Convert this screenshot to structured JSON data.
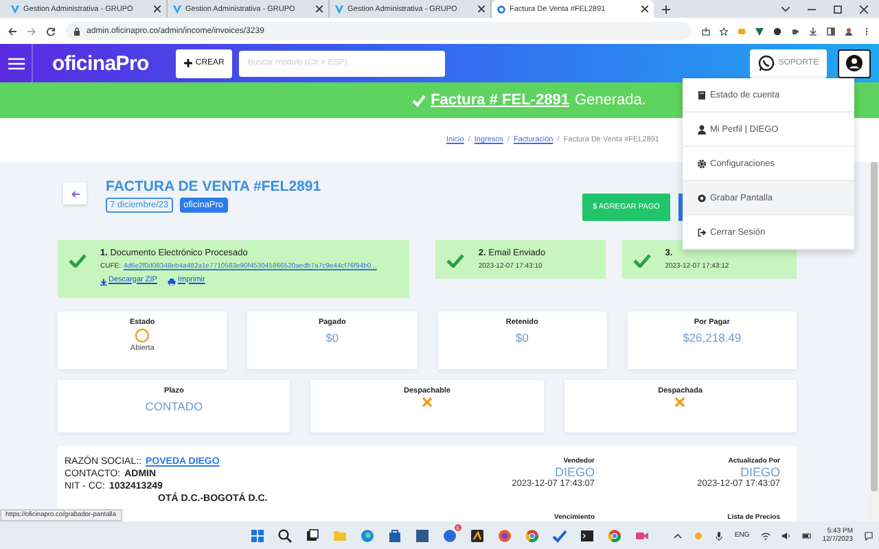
{
  "browser": {
    "tabs": [
      {
        "title": "Gestion Administrativa - GRUPO",
        "selected": false
      },
      {
        "title": "Gestion Administrativa - GRUPO",
        "selected": false
      },
      {
        "title": "Gestion Administrativa - GRUPO",
        "selected": false
      },
      {
        "title": "Factura De Venta #FEL2891",
        "selected": true
      }
    ],
    "address": "admin.oficinapro.co/admin/income/invoices/3239"
  },
  "header": {
    "logo": "oficinaPro",
    "create_button": "CREAR",
    "search": {
      "placeholder": "Buscar módulo (Ctr + ESP)"
    },
    "support_button": "SOPORTE"
  },
  "banner": {
    "link": "Factura # FEL-2891",
    "text": "Generada."
  },
  "breadcrumb_separator": "/",
  "breadcrumb": [
    {
      "label": "Inicio",
      "link": true
    },
    {
      "label": "Ingresos",
      "link": true
    },
    {
      "label": "Facturación",
      "link": true
    },
    {
      "label": "Factura De Venta #FEL2891",
      "link": false
    }
  ],
  "invoice": {
    "title": "FACTURA DE VENTA #FEL2891",
    "date": "7 diciembre/23",
    "tag": "oficinaPro",
    "pay_button": "$ AGREGAR PAGO"
  },
  "steps": [
    {
      "number": "1.",
      "title": "Documento Electrónico Procesado",
      "cufe_label": "CUFE:",
      "cufe": "4d6e2f0d08348eb4a482a1e7710583e90f453045866520aedb7a7c9e44cf76f94b0...",
      "links": [
        "Descargar ZIP",
        "Imprimir"
      ]
    },
    {
      "number": "2.",
      "title": "Email Enviado",
      "time": "2023-12-07 17:43:10"
    },
    {
      "number": "3.",
      "time": "2023-12-07 17:43:12"
    }
  ],
  "summary": [
    {
      "label": "Estado",
      "kind": "status",
      "value": "Abierta"
    },
    {
      "label": "Pagado",
      "kind": "amount",
      "value": "$0"
    },
    {
      "label": "Retenido",
      "kind": "amount",
      "value": "$0"
    },
    {
      "label": "Por Pagar",
      "kind": "amount",
      "value": "$26,218.49"
    }
  ],
  "shipping": [
    {
      "label": "Plazo",
      "kind": "text",
      "value": "CONTADO"
    },
    {
      "label": "Despachable",
      "kind": "flag",
      "on": false
    },
    {
      "label": "Despachada",
      "kind": "flag",
      "on": false
    }
  ],
  "client": [
    {
      "label": "RAZÓN SOCIAL::",
      "value": "POVEDA DIEGO",
      "link": true
    },
    {
      "label": "CONTACTO:",
      "value": "ADMIN",
      "link": false
    },
    {
      "label": "NIT - CC:",
      "value": "1032413249",
      "link": false
    },
    {
      "value": "OTÁ D.C.-BOGOTÁ D.C.",
      "link": false
    }
  ],
  "people": [
    {
      "label": "Vendedor",
      "name": "DIEGO",
      "time": "2023-12-07 17:43:07"
    },
    {
      "label": "Actualizado Por",
      "name": "DIEGO",
      "time": "2023-12-07 17:43:07"
    },
    {
      "label": "Vencimiento"
    },
    {
      "label": "Lista de Precios"
    }
  ],
  "menu": [
    {
      "label": "Estado de cuenta",
      "kind": "book",
      "selected": false
    },
    {
      "label": "Mi Perfil | DIEGO",
      "kind": "user",
      "selected": false
    },
    {
      "label": "Configuraciones",
      "kind": "gear",
      "selected": false
    },
    {
      "label": "Grabar Pantalla",
      "kind": "record",
      "selected": true
    },
    {
      "label": "Cerrar Sesión",
      "kind": "logout",
      "selected": false
    }
  ],
  "status_url": "https://oficinapro.co/grabador-pantalla",
  "taskbar": {
    "badge": "6",
    "language": "ENG",
    "time": "5:43 PM",
    "date": "12/7/2023"
  }
}
